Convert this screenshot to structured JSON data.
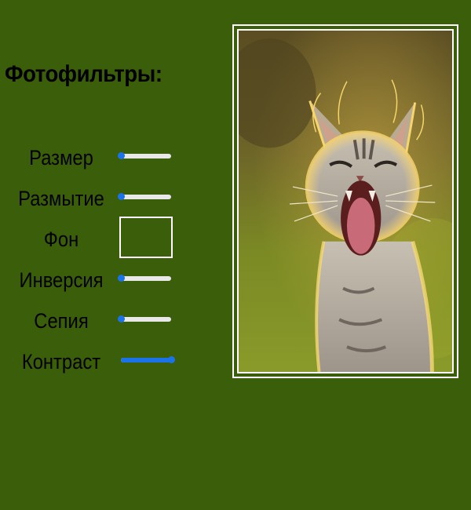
{
  "header": {
    "title": "Фотофильтры:"
  },
  "filters": [
    {
      "label": "Размер",
      "type": "slider",
      "value": 0
    },
    {
      "label": "Размытие",
      "type": "slider",
      "value": 0
    },
    {
      "label": "Фон",
      "type": "color",
      "value": "#3a5e0a"
    },
    {
      "label": "Инверсия",
      "type": "slider",
      "value": 0
    },
    {
      "label": "Сепия",
      "type": "slider",
      "value": 0
    },
    {
      "label": "Контраст",
      "type": "slider",
      "value": 1
    }
  ],
  "preview": {
    "subject": "yawning kitten photo"
  },
  "colors": {
    "background": "#3a5e0a",
    "accent": "#1a73e8",
    "slider_track": "#e8e8e8",
    "frame": "#ffffff"
  }
}
